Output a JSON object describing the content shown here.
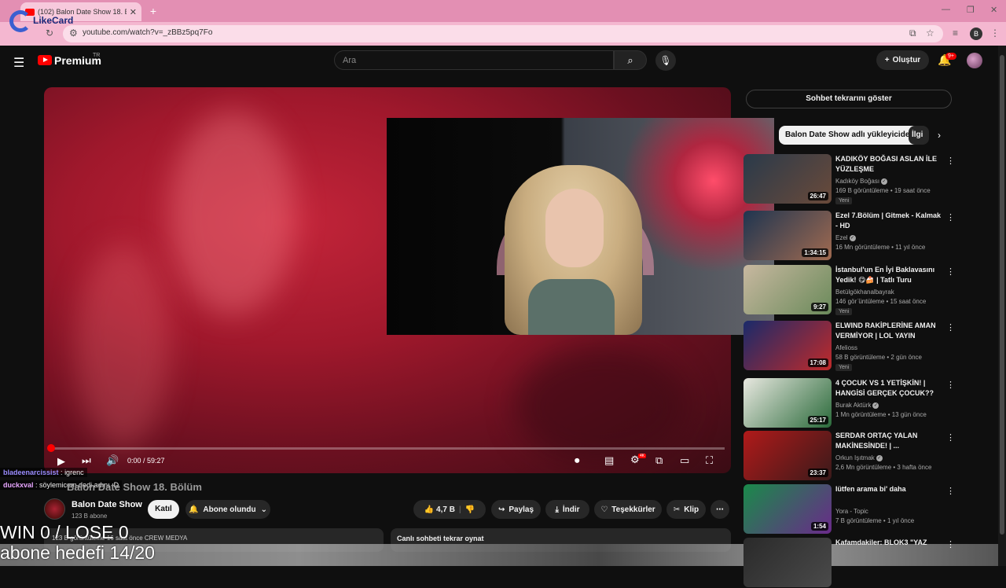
{
  "browser": {
    "tab_title": "(102) Balon Date Show 18. Böl",
    "url": "youtube.com/watch?v=_zBBz5pq7Fo",
    "profile_letter": "B"
  },
  "overlay_brand": "LikeCard",
  "header": {
    "logo_text": "Premium",
    "region": "TR",
    "search_placeholder": "Ara",
    "create_label": "Oluştur",
    "notif_badge": "9+"
  },
  "player": {
    "time": "0:00 / 59:27"
  },
  "stream_overlay": {
    "chat": [
      {
        "user": "bladeenarcissist",
        "sep": " : ",
        "msg": "igrenc"
      },
      {
        "user": "duckxval",
        "sep": " : ",
        "msg": "söylemicem dedi adını :D"
      }
    ],
    "title_ghost": "Balon Date Show 18. Bölüm",
    "win_lose": "WIN 0 / LOSE 0",
    "goal": "abone hedefi 14/20"
  },
  "channel": {
    "name": "Balon Date Show",
    "subs": "123 B abone",
    "join": "Katıl",
    "subscribed": "Abone olundu"
  },
  "actions": {
    "likes": "4,7 B",
    "share": "Paylaş",
    "download": "İndir",
    "thanks": "Teşekkürler",
    "clip": "Klip"
  },
  "description": {
    "text": "123 B görüntüleme  16 saat önce  CREW MEDYA"
  },
  "live_replay": "Canlı sohbeti tekrar oynat",
  "sidebar": {
    "chat_replay": "Sohbet tekrarını göster",
    "chips": [
      "Balon Date Show adlı yükleyiciden",
      "İlgi"
    ],
    "recommendations": [
      {
        "title": "KADIKÖY BOĞASI ASLAN İLE YÜZLEŞME",
        "channel": "Kadıköy Boğası",
        "verified": true,
        "meta": "169 B görüntüleme • 19 saat önce",
        "badge": "Yeni",
        "duration": "26:47",
        "c1": "#2a3a4a",
        "c2": "#6a4a3a"
      },
      {
        "title": "Ezel 7.Bölüm | Gitmek - Kalmak - HD",
        "channel": "Ezel",
        "verified": true,
        "meta": "16 Mn görüntüleme • 11 yıl önce",
        "badge": "",
        "duration": "1:34:15",
        "c1": "#1f3550",
        "c2": "#a06a50"
      },
      {
        "title": "İstanbul'un En İyi Baklavasını Yedik! 😋🍰 | Tatlı Turu",
        "channel": "Betülgökhanalbayrak",
        "verified": false,
        "meta": "146 gör ̈üntüleme • 15 saat önce",
        "badge": "Yeni",
        "duration": "9:27",
        "c1": "#c8b8a0",
        "c2": "#6a8a5a"
      },
      {
        "title": "ELWIND RAKİPLERİNE AMAN VERMİYOR | LOL YAYIN ANLA...",
        "channel": "Afelioss",
        "verified": false,
        "meta": "58 B görüntüleme • 2 gün önce",
        "badge": "Yeni",
        "duration": "17:08",
        "c1": "#1a2a6a",
        "c2": "#c02a2a"
      },
      {
        "title": "4 ÇOCUK VS 1 YETİŞKİN! | HANGİSİ GERÇEK ÇOCUK??",
        "channel": "Burak Aktürk",
        "verified": true,
        "meta": "1 Mn görüntüleme • 13 gün önce",
        "badge": "",
        "duration": "25:17",
        "c1": "#e8e8e0",
        "c2": "#2a6a3a"
      },
      {
        "title": "SERDAR ORTAÇ YALAN MAKİNESİNDE! | ...",
        "channel": "Orkun Işıtmak",
        "verified": true,
        "meta": "2,6 Mn görüntüleme • 3 hafta önce",
        "badge": "",
        "duration": "23:37",
        "c1": "#b01a1a",
        "c2": "#3a1a1a"
      },
      {
        "title": "lütfen arama bi' daha",
        "channel": "Yora - Topic",
        "verified": false,
        "meta": "7 B görüntüleme • 1 yıl önce",
        "badge": "",
        "duration": "1:54",
        "c1": "#1a8a4a",
        "c2": "#6a2a8a"
      },
      {
        "title": "Kafamdakiler: BLOK3 \"YAZ",
        "channel": "",
        "verified": false,
        "meta": "",
        "badge": "",
        "duration": "",
        "c1": "#2a2a2a",
        "c2": "#4a4a4a"
      }
    ]
  }
}
